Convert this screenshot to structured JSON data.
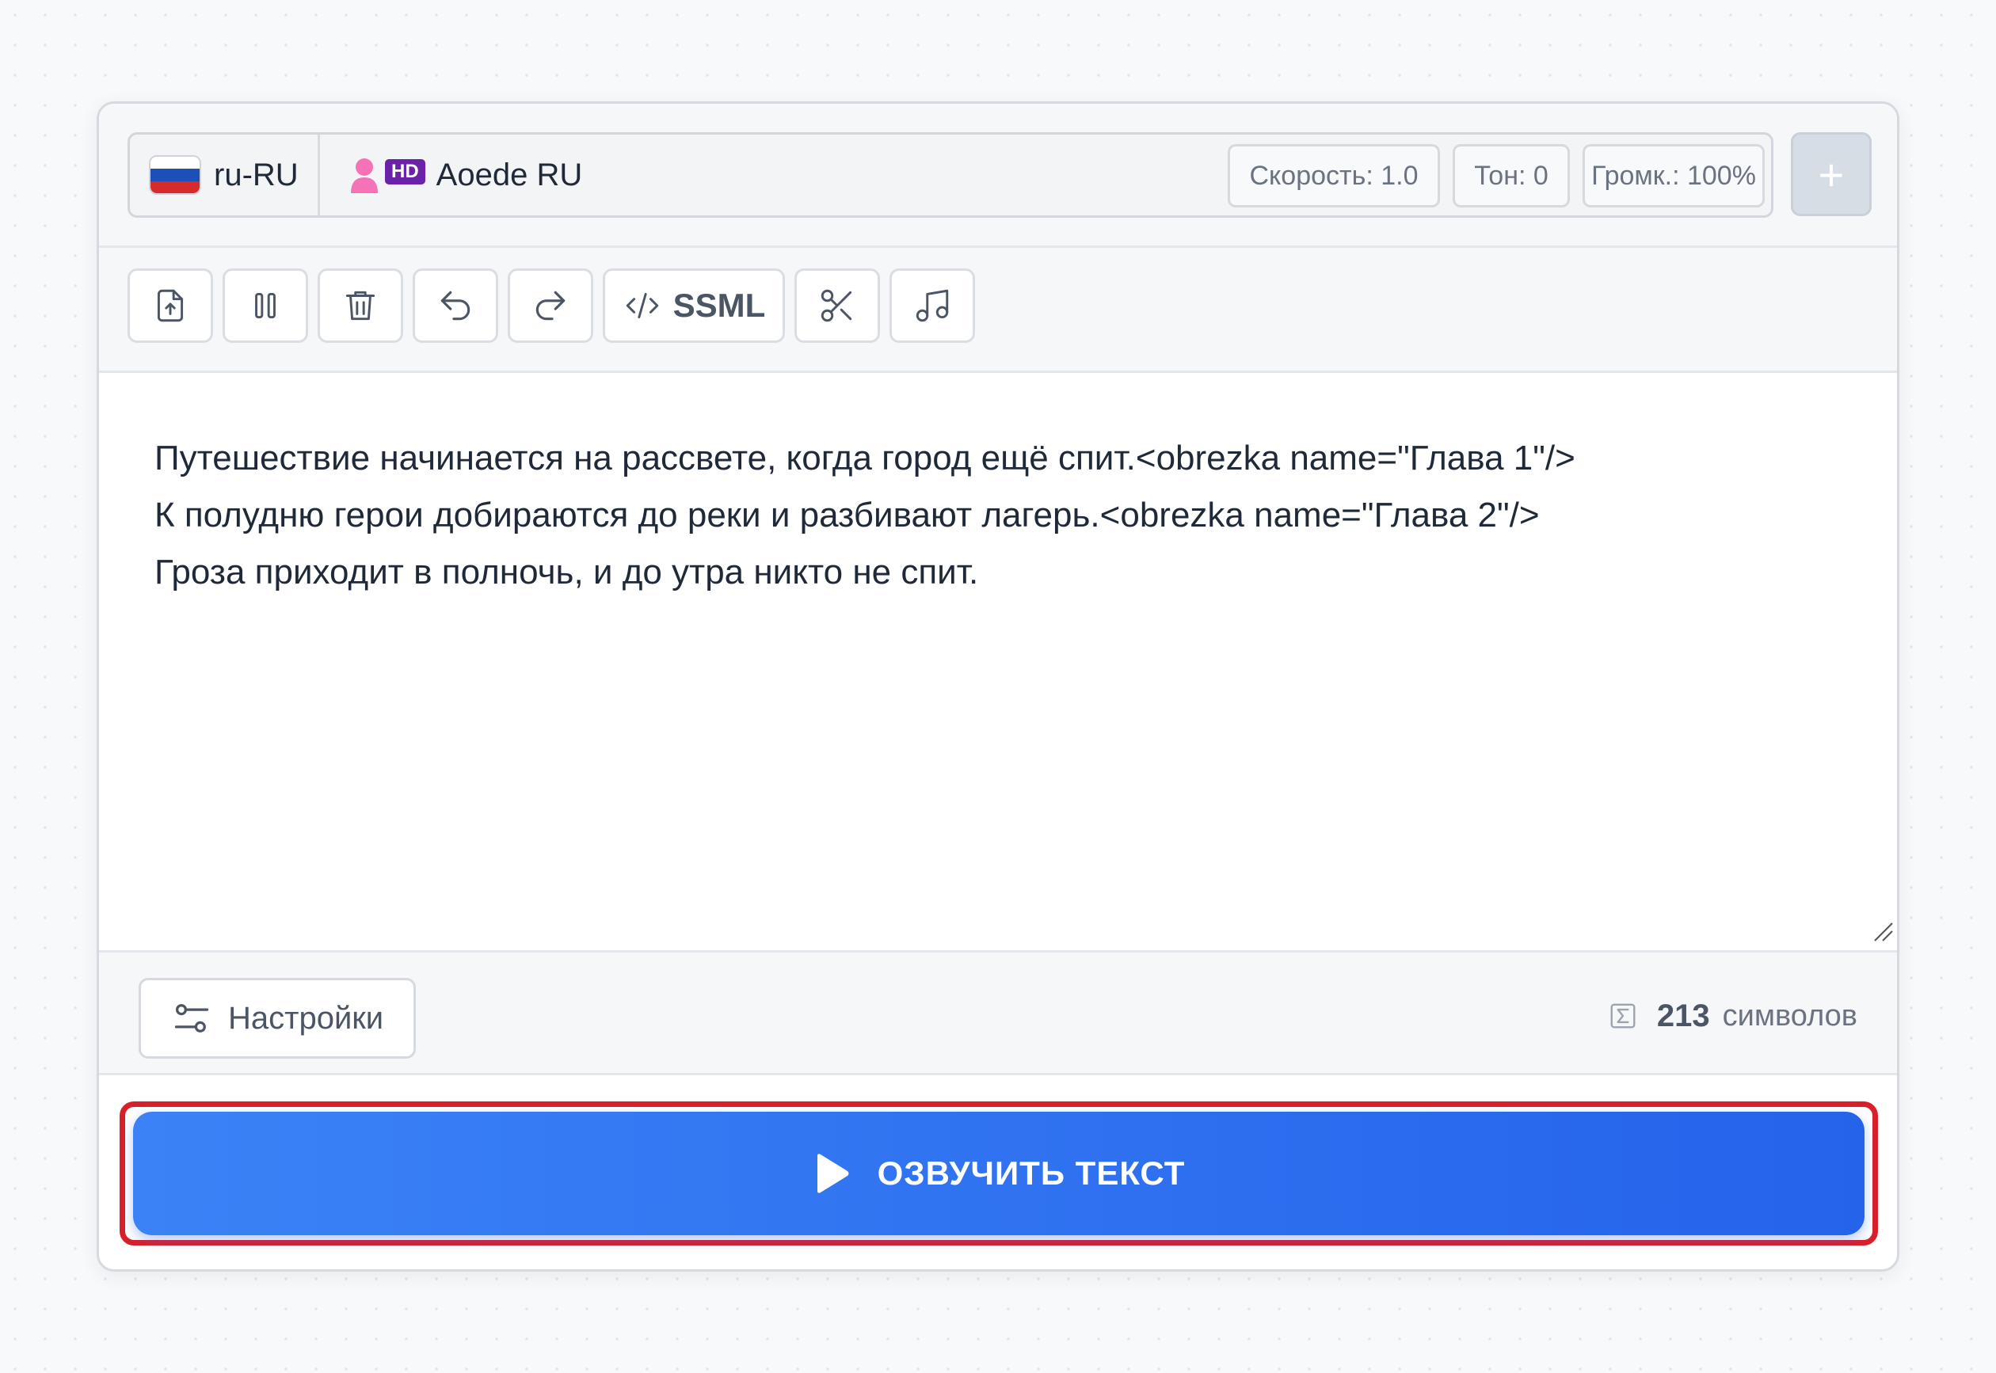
{
  "voice_bar": {
    "language": "ru-RU",
    "voice_badge": "HD",
    "voice_name": "Aoede RU",
    "speed_label": "Скорость: 1.0",
    "pitch_label": "Тон: 0",
    "volume_label": "Громк.: 100%",
    "add_label": "+"
  },
  "toolbar": {
    "icons": [
      "upload-icon",
      "pause-icon",
      "trash-icon",
      "undo-icon",
      "redo-icon",
      "code-icon",
      "scissors-icon",
      "music-note-icon"
    ],
    "ssml_label": "SSML"
  },
  "editor": {
    "lines": [
      "Путешествие начинается на рассвете, когда город ещё спит.<obrezka name=\"Глава 1\"/>",
      "К полудню герои добираются до реки и разбивают лагерь.<obrezka name=\"Глава 2\"/>",
      "Гроза приходит в полночь, и до утра никто не спит."
    ]
  },
  "footer": {
    "settings_label": "Настройки",
    "char_count": "213",
    "char_unit": "символов"
  },
  "speak": {
    "label": "ОЗВУЧИТЬ ТЕКСТ"
  },
  "colors": {
    "accent": "#3b82f6",
    "accent_dark": "#2563eb",
    "highlight": "#d9202a",
    "hd_badge": "#6b21a8"
  }
}
